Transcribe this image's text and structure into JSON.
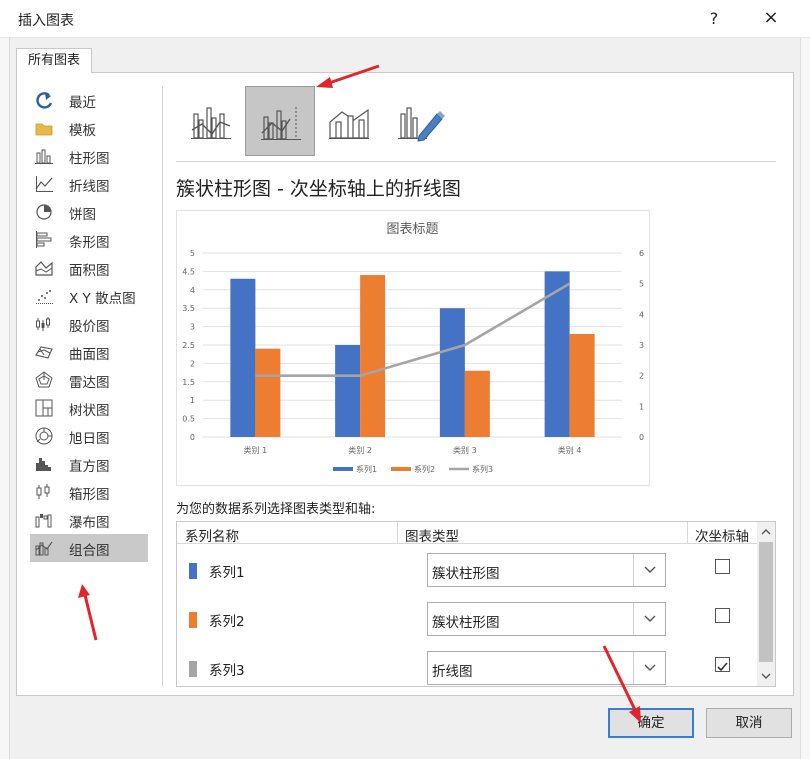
{
  "dialog": {
    "title": "插入图表",
    "help": "?",
    "close": "×"
  },
  "tab": {
    "label": "所有图表"
  },
  "categories": [
    {
      "label": "最近",
      "icon": "recent-icon"
    },
    {
      "label": "模板",
      "icon": "folder-icon"
    },
    {
      "label": "柱形图",
      "icon": "column-chart-icon"
    },
    {
      "label": "折线图",
      "icon": "line-chart-icon"
    },
    {
      "label": "饼图",
      "icon": "pie-chart-icon"
    },
    {
      "label": "条形图",
      "icon": "bar-chart-icon"
    },
    {
      "label": "面积图",
      "icon": "area-chart-icon"
    },
    {
      "label": "X Y 散点图",
      "icon": "scatter-chart-icon"
    },
    {
      "label": "股价图",
      "icon": "stock-chart-icon"
    },
    {
      "label": "曲面图",
      "icon": "surface-chart-icon"
    },
    {
      "label": "雷达图",
      "icon": "radar-chart-icon"
    },
    {
      "label": "树状图",
      "icon": "treemap-chart-icon"
    },
    {
      "label": "旭日图",
      "icon": "sunburst-chart-icon"
    },
    {
      "label": "直方图",
      "icon": "histogram-chart-icon"
    },
    {
      "label": "箱形图",
      "icon": "boxplot-chart-icon"
    },
    {
      "label": "瀑布图",
      "icon": "waterfall-chart-icon"
    },
    {
      "label": "组合图",
      "icon": "combo-chart-icon",
      "active": true
    }
  ],
  "subtypes": [
    {
      "icon": "clustered-column-line-icon",
      "selected": false
    },
    {
      "icon": "clustered-column-line-secondary-axis-icon",
      "selected": true
    },
    {
      "icon": "stacked-area-clustered-column-icon",
      "selected": false
    },
    {
      "icon": "custom-combination-icon",
      "selected": false
    }
  ],
  "heading": "簇状柱形图 - 次坐标轴上的折线图",
  "chart_data": {
    "type": "bar",
    "title": "图表标题",
    "categories": [
      "类别 1",
      "类别 2",
      "类别 3",
      "类别 4"
    ],
    "series": [
      {
        "name": "系列1",
        "type": "bar",
        "axis": "primary",
        "color": "#4472c4",
        "values": [
          4.3,
          2.5,
          3.5,
          4.5
        ]
      },
      {
        "name": "系列2",
        "type": "bar",
        "axis": "primary",
        "color": "#ed7d31",
        "values": [
          2.4,
          4.4,
          1.8,
          2.8
        ]
      },
      {
        "name": "系列3",
        "type": "line",
        "axis": "secondary",
        "color": "#a5a5a5",
        "values": [
          2,
          2,
          3,
          5
        ]
      }
    ],
    "ylim": [
      0,
      5
    ],
    "y_ticks": [
      "0",
      "0.5",
      "1",
      "1.5",
      "2",
      "2.5",
      "3",
      "3.5",
      "4",
      "4.5",
      "5"
    ],
    "y2lim": [
      0,
      6
    ],
    "y2_ticks": [
      "0",
      "1",
      "2",
      "3",
      "4",
      "5",
      "6"
    ],
    "grid": true,
    "legend": "bottom"
  },
  "instruction": "为您的数据系列选择图表类型和轴:",
  "table": {
    "headers": {
      "name": "系列名称",
      "type": "图表类型",
      "secondary": "次坐标轴"
    },
    "rows": [
      {
        "name": "系列1",
        "color": "#4472c4",
        "chart_type": "簇状柱形图",
        "secondary": false
      },
      {
        "name": "系列2",
        "color": "#ed7d31",
        "chart_type": "簇状柱形图",
        "secondary": false
      },
      {
        "name": "系列3",
        "color": "#a5a5a5",
        "chart_type": "折线图",
        "secondary": true
      }
    ]
  },
  "buttons": {
    "ok": "确定",
    "cancel": "取消"
  },
  "annotation_color": "#e0262b"
}
